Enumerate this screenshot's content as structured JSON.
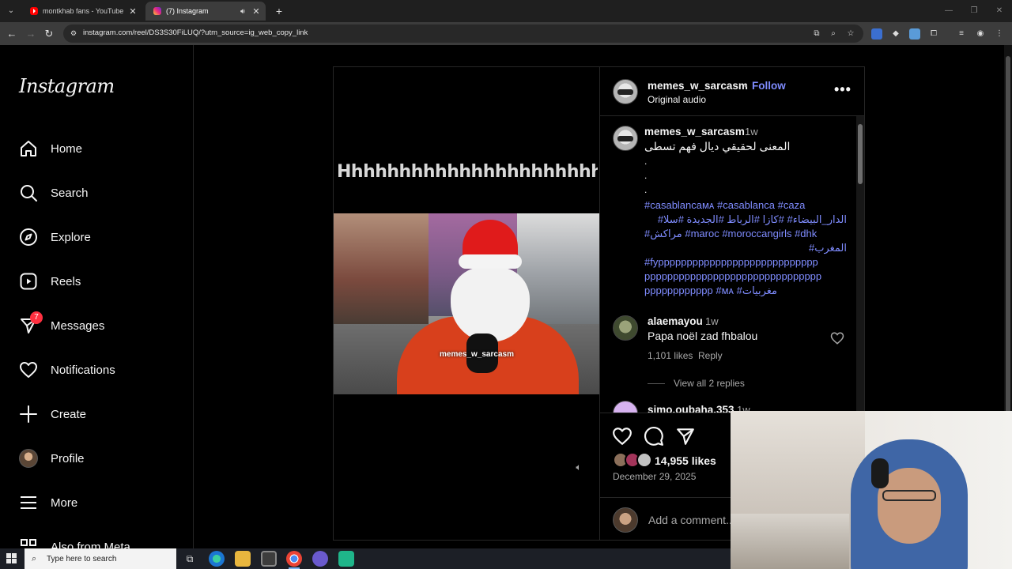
{
  "browser": {
    "tabs": [
      {
        "title": "montkhab fans - YouTube",
        "favicon": "youtube-icon",
        "active": false
      },
      {
        "title": "(7) Instagram",
        "favicon": "instagram-icon",
        "active": true
      }
    ],
    "url": "instagram.com/reel/DS3S30FiLUQ/?utm_source=ig_web_copy_link"
  },
  "sidebar": {
    "logo": "Instagram",
    "items": [
      {
        "label": "Home",
        "icon": "home-icon"
      },
      {
        "label": "Search",
        "icon": "search-icon"
      },
      {
        "label": "Explore",
        "icon": "compass-icon"
      },
      {
        "label": "Reels",
        "icon": "reels-icon"
      },
      {
        "label": "Messages",
        "icon": "messenger-icon",
        "badge": "7"
      },
      {
        "label": "Notifications",
        "icon": "heart-icon"
      },
      {
        "label": "Create",
        "icon": "plus-icon"
      },
      {
        "label": "Profile",
        "icon": "avatar"
      },
      {
        "label": "More",
        "icon": "menu-icon"
      },
      {
        "label": "Also from Meta",
        "icon": "meta-icon"
      }
    ]
  },
  "reel": {
    "overlay_text": "Hhhhhhhhhhhhhhhhhhhhhhhh",
    "watermark": "memes_w_sarcasm"
  },
  "post": {
    "author": "memes_w_sarcasm",
    "separator": "•",
    "follow_label": "Follow",
    "audio": "Original audio",
    "caption": {
      "user": "memes_w_sarcasm",
      "time": "1w",
      "text": "المعنى لحقيقي ديال فهم تسطى",
      "dots": [
        ".",
        ".",
        "."
      ],
      "hashtag_lines": [
        {
          "text": "#casablancaᴍᴀ #casablanca #caza",
          "rtl": false
        },
        {
          "text": "الدار_البيضاء# #كازا #الرباط #الجديدة #سلا#",
          "rtl": true
        },
        {
          "text": "#مراكش #maroc #moroccangirls #dhk",
          "rtl": false
        },
        {
          "text": "المغرب#",
          "rtl": true
        },
        {
          "text": "#fypppppppppppppppppppppppppppp",
          "rtl": false
        },
        {
          "text": "ppppppppppppppppppppppppppppppp",
          "rtl": false
        },
        {
          "text": "pppppppppppp #ᴍᴀ #مغربيات",
          "rtl": false
        }
      ]
    },
    "comments": [
      {
        "user": "alaemayou",
        "time": "1w",
        "text": "Papa noël zad fhbalou",
        "likes": "1,101 likes",
        "reply": "Reply",
        "view_replies": "View all 2 replies"
      },
      {
        "user": "simo.oubaha.353",
        "time": "1w"
      }
    ],
    "likes": "14,955 likes",
    "date": "December 29, 2025",
    "comment_placeholder": "Add a comment..."
  },
  "taskbar": {
    "search_placeholder": "Type here to search"
  },
  "colors": {
    "accent_blue": "#7f8cff",
    "notification_badge": "#ff3040",
    "background": "#000000"
  }
}
